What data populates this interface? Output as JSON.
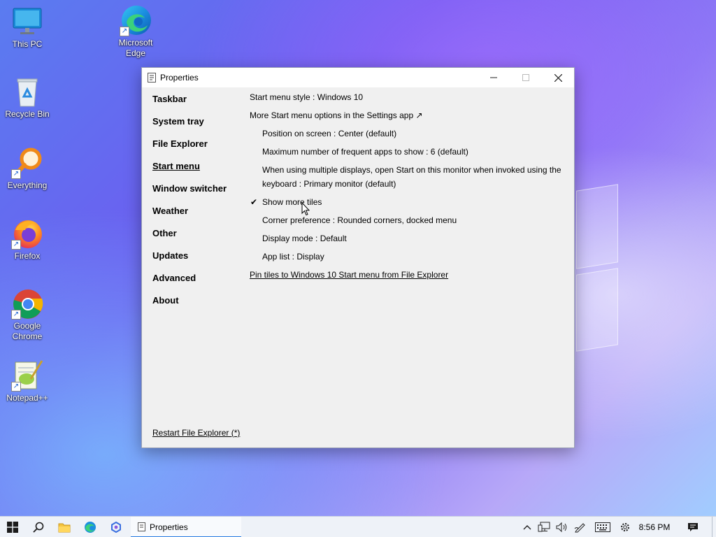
{
  "desktop": {
    "icons": [
      {
        "label": "This PC",
        "icon": "computer-icon"
      },
      {
        "label": "Microsoft Edge",
        "icon": "edge-icon"
      },
      {
        "label": "Recycle Bin",
        "icon": "recycle-bin-icon"
      },
      {
        "label": "Everything",
        "icon": "everything-search-icon"
      },
      {
        "label": "Firefox",
        "icon": "firefox-icon"
      },
      {
        "label": "Google Chrome",
        "icon": "chrome-icon"
      },
      {
        "label": "Notepad++",
        "icon": "notepadpp-icon"
      }
    ]
  },
  "window": {
    "title": "Properties",
    "nav": [
      {
        "label": "Taskbar"
      },
      {
        "label": "System tray"
      },
      {
        "label": "File Explorer"
      },
      {
        "label": "Start menu",
        "active": true
      },
      {
        "label": "Window switcher"
      },
      {
        "label": "Weather"
      },
      {
        "label": "Other"
      },
      {
        "label": "Updates"
      },
      {
        "label": "Advanced"
      },
      {
        "label": "About"
      }
    ],
    "settings": {
      "start_menu_style": "Start menu style : Windows 10",
      "more_options": "More Start menu options in the Settings app",
      "external_arrow": "↗",
      "position": "Position on screen : Center (default)",
      "max_frequent": "Maximum number of frequent apps to show : 6 (default)",
      "multi_display": "When using multiple displays, open Start on this monitor when invoked using the keyboard : Primary monitor (default)",
      "show_more_tiles": "Show more tiles",
      "show_more_tiles_checked": true,
      "check_mark": "✔",
      "corner_pref": "Corner preference : Rounded corners, docked menu",
      "display_mode": "Display mode : Default",
      "app_list": "App list : Display",
      "pin_tiles": "Pin tiles to Windows 10 Start menu from File Explorer"
    },
    "restart_label": "Restart File Explorer (*)"
  },
  "taskbar": {
    "active_task": "Properties",
    "clock": "8:56 PM",
    "accent": "#2a7de1"
  }
}
